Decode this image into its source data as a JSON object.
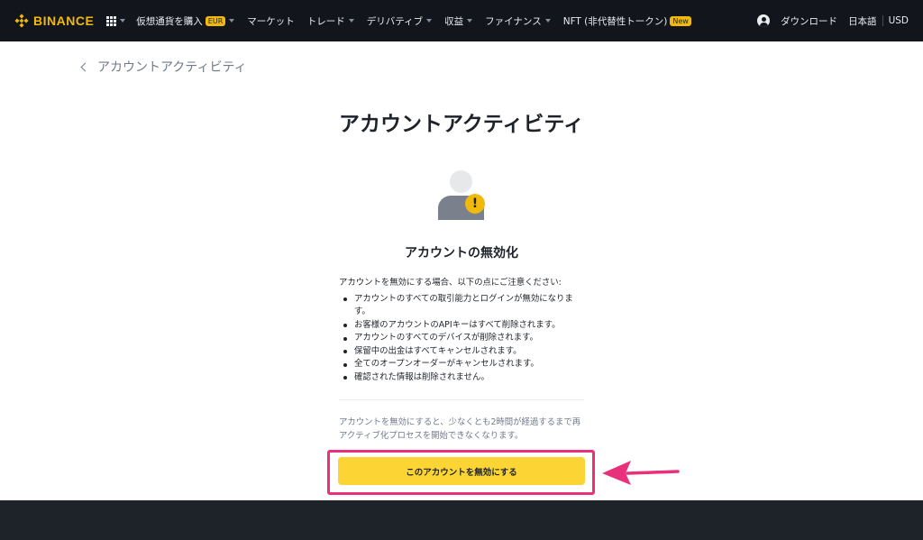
{
  "nav": {
    "logo": "BINANCE",
    "items": [
      {
        "label": "仮想通貨を購入",
        "badge": "EUR"
      },
      {
        "label": "マーケット"
      },
      {
        "label": "トレード"
      },
      {
        "label": "デリバティブ"
      },
      {
        "label": "収益"
      },
      {
        "label": "ファイナンス"
      },
      {
        "label": "NFT (非代替性トークン)",
        "badge": "New"
      }
    ],
    "download": "ダウンロード",
    "language": "日本語",
    "currency": "USD"
  },
  "breadcrumb": {
    "back_label": "アカウントアクティビティ"
  },
  "page": {
    "title": "アカウントアクティビティ",
    "section_title": "アカウントの無効化",
    "intro": "アカウントを無効にする場合、以下の点にご注意ください:",
    "bullets": [
      "アカウントのすべての取引能力とログインが無効になります。",
      "お客様のアカウントのAPIキーはすべて削除されます。",
      "アカウントのすべてのデバイスが削除されます。",
      "保留中の出金はすべてキャンセルされます。",
      "全てのオープンオーダーがキャンセルされます。",
      "確認された情報は削除されません。"
    ],
    "note": "アカウントを無効にすると、少なくとも2時間が経過するまで再アクティブ化プロセスを開始できなくなります。",
    "button_label": "このアカウントを無効にする"
  },
  "colors": {
    "brand": "#f0b90b",
    "button": "#fcd535",
    "highlight": "#e8317a",
    "nav_bg": "#12161c"
  },
  "icons": {
    "logo": "binance-diamond-icon",
    "apps": "grid-icon",
    "user": "user-circle-icon",
    "back": "chevron-left-icon",
    "avatar": "user-alert-icon",
    "annotation": "arrow-left-icon"
  }
}
